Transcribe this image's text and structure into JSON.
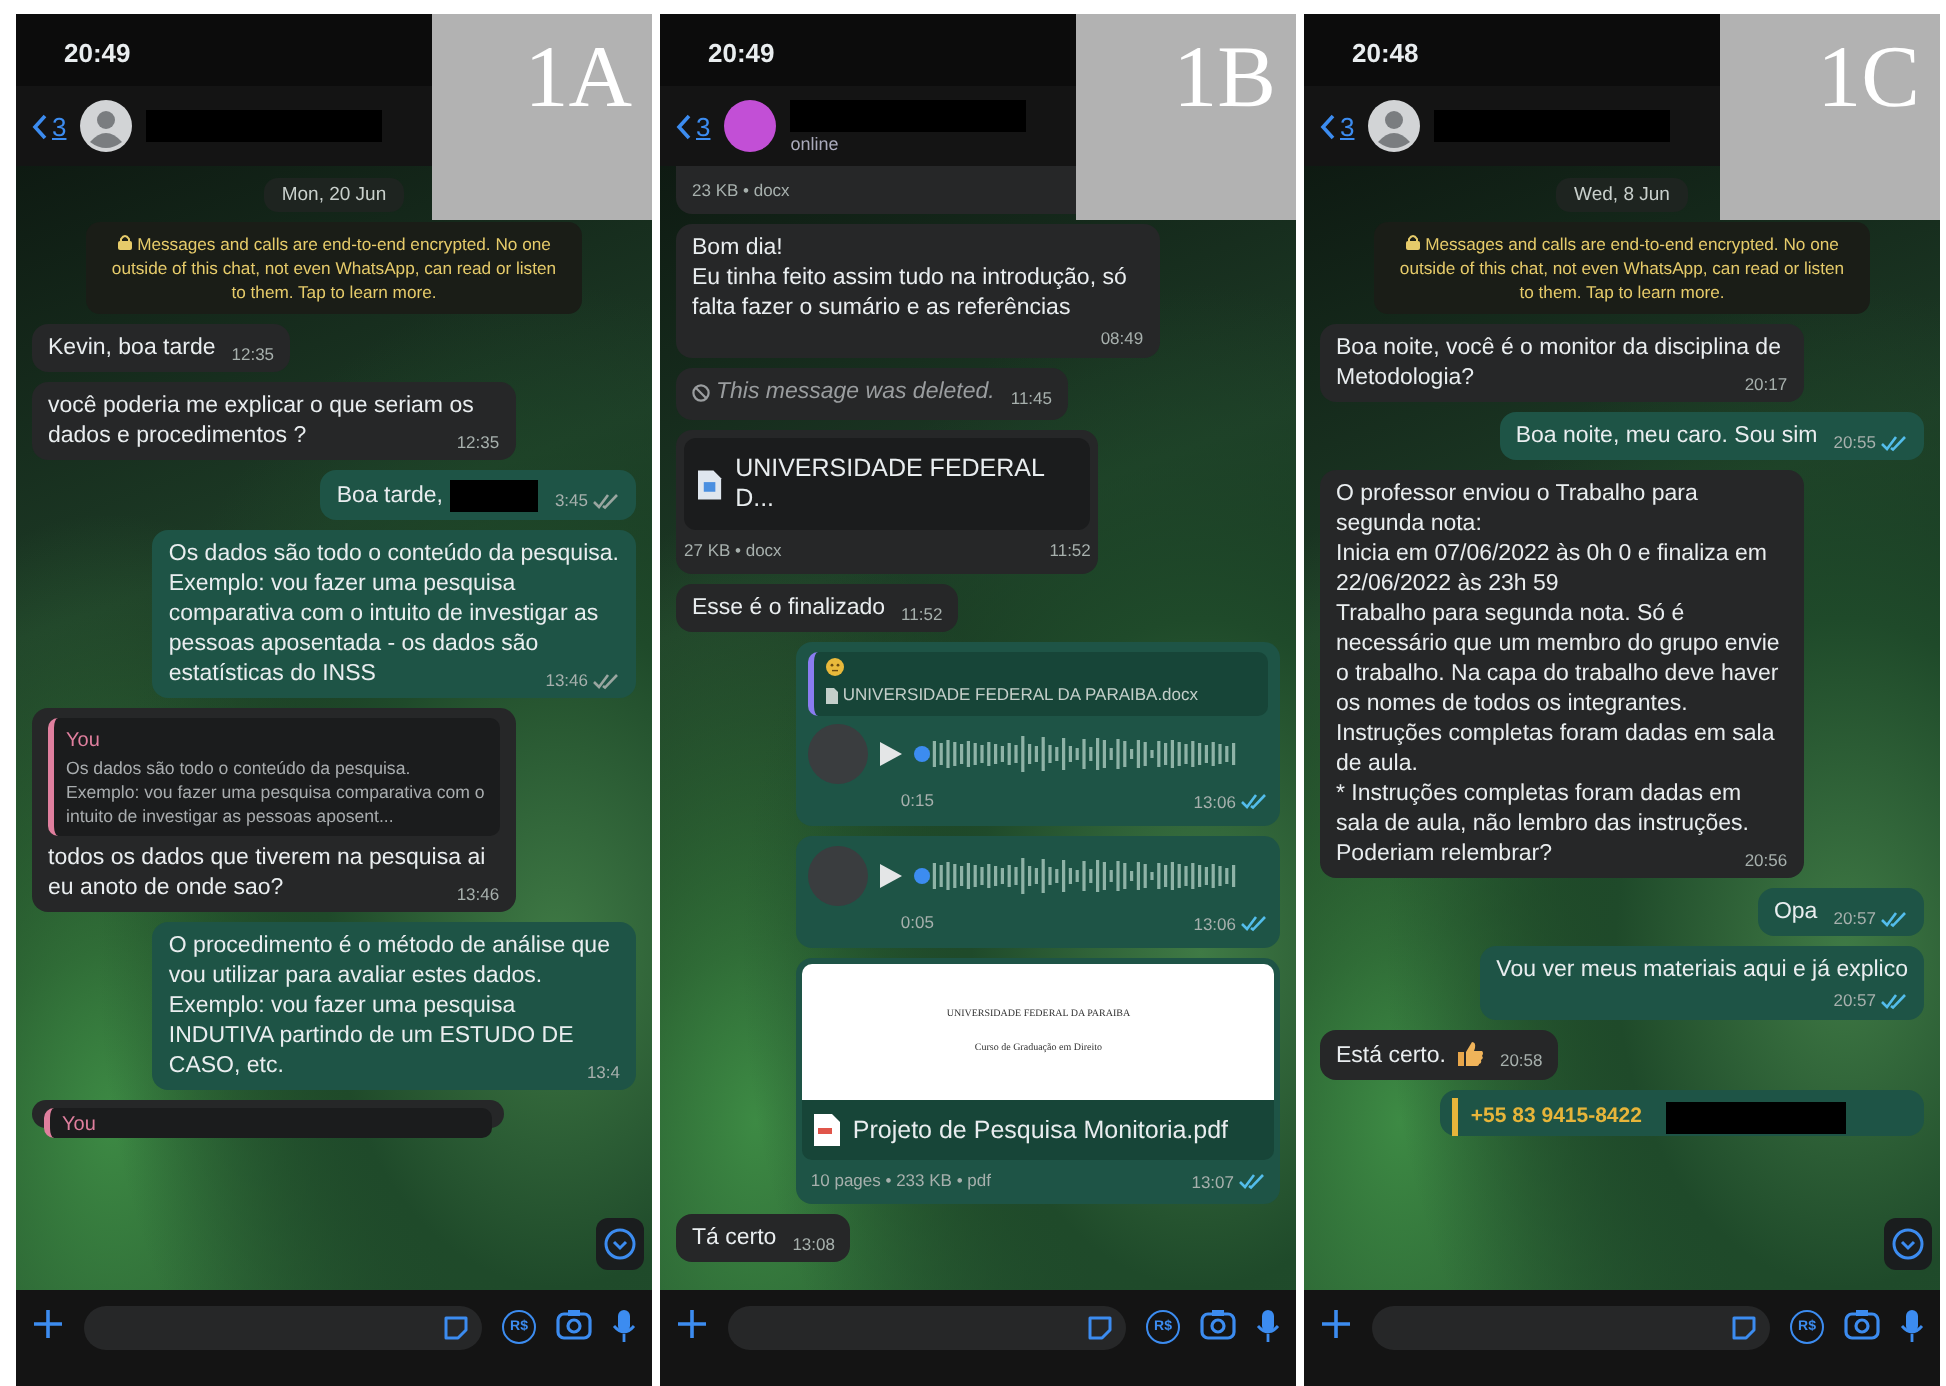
{
  "panels": [
    {
      "label": "1A",
      "status_time": "20:49",
      "back_count": "3",
      "avatar": {
        "kind": "silhouette"
      },
      "scroll_button": true,
      "payment_label": "R$",
      "messages": [
        {
          "kind": "date",
          "text": "Mon, 20 Jun"
        },
        {
          "kind": "system",
          "text": "Messages and calls are end-to-end encrypted. No one outside of this chat, not even WhatsApp, can read or listen to them. Tap to learn more."
        },
        {
          "kind": "in",
          "text": "Kevin, boa tarde",
          "time": "12:35"
        },
        {
          "kind": "in",
          "text": "você poderia me explicar o que seriam os dados e procedimentos ?",
          "time": "12:35"
        },
        {
          "kind": "out",
          "text": "Boa tarde,",
          "redacted": true,
          "time": "3:45",
          "read": false
        },
        {
          "kind": "out",
          "text": "Os dados são todo o conteúdo da pesquisa. Exemplo: vou fazer uma pesquisa comparativa com o intuito de investigar as pessoas aposentada - os dados são estatísticas do INSS",
          "time": "13:46",
          "read": false
        },
        {
          "kind": "in",
          "quote": {
            "author": "You",
            "text": "Os dados são todo o conteúdo da pesquisa. Exemplo: vou fazer uma pesquisa comparativa com o intuito de investigar as pessoas aposent..."
          },
          "text": "todos os dados que tiverem na pesquisa ai eu anoto de onde sao?",
          "time": "13:46"
        },
        {
          "kind": "out",
          "text": "O procedimento é o método de análise que vou utilizar para avaliar estes dados. Exemplo: vou fazer uma pesquisa INDUTIVA partindo de um ESTUDO DE CASO, etc.",
          "time": "13:4"
        },
        {
          "kind": "quote_stub",
          "author": "You"
        }
      ]
    },
    {
      "label": "1B",
      "status_time": "20:49",
      "back_count": "3",
      "avatar": {
        "kind": "photo"
      },
      "contact_status": "online",
      "payment_label": "R$",
      "messages": [
        {
          "kind": "doc_meta",
          "meta": "23 KB • docx"
        },
        {
          "kind": "in",
          "text": "Bom dia!\nEu tinha feito assim tudo na introdução, só falta fazer o sumário e as referências",
          "time": "08:49",
          "time_below": true
        },
        {
          "kind": "deleted",
          "text": "This message was deleted.",
          "time": "11:45"
        },
        {
          "kind": "doc",
          "name": "UNIVERSIDADE FEDERAL D...",
          "meta": "27 KB • docx",
          "time": "11:52"
        },
        {
          "kind": "in",
          "text": "Esse é o finalizado",
          "time": "11:52"
        },
        {
          "kind": "voice",
          "quote": {
            "text": "UNIVERSIDADE FEDERAL DA PARAIBA.docx"
          },
          "duration": "0:15",
          "time": "13:06",
          "read": true,
          "level": 0
        },
        {
          "kind": "voice",
          "duration": "0:05",
          "time": "13:06",
          "read": true,
          "level": 0
        },
        {
          "kind": "pdf",
          "preview_lines": [
            "UNIVERSIDADE FEDERAL DA PARAIBA",
            "Curso de Graduação em Direito"
          ],
          "name": "Projeto de Pesquisa Monitoria.pdf",
          "meta": "10 pages • 233 KB • pdf",
          "time": "13:07",
          "read": true
        },
        {
          "kind": "in",
          "text": "Tá certo",
          "time": "13:08"
        }
      ]
    },
    {
      "label": "1C",
      "status_time": "20:48",
      "back_count": "3",
      "avatar": {
        "kind": "silhouette"
      },
      "scroll_button": true,
      "payment_label": "R$",
      "messages": [
        {
          "kind": "date",
          "text": "Wed, 8 Jun"
        },
        {
          "kind": "system",
          "text": "Messages and calls are end-to-end encrypted. No one outside of this chat, not even WhatsApp, can read or listen to them. Tap to learn more."
        },
        {
          "kind": "in",
          "text": "Boa noite, você é o monitor da disciplina de Metodologia?",
          "time": "20:17"
        },
        {
          "kind": "out",
          "text": "Boa noite, meu caro. Sou sim",
          "time": "20:55",
          "read": true
        },
        {
          "kind": "in",
          "text": "O professor enviou o Trabalho para segunda nota:\nInicia em 07/06/2022 às 0h 0 e finaliza em 22/06/2022 às 23h 59\nTrabalho para segunda nota. Só é necessário que um membro do grupo envie o trabalho. Na capa do trabalho deve haver os nomes de todos os integrantes. Instruções completas foram dadas em sala de aula.\n* Instruções completas foram dadas em sala de aula, não lembro das instruções. Poderiam relembrar?",
          "time": "20:56"
        },
        {
          "kind": "out",
          "text": "Opa",
          "time": "20:57",
          "read": true
        },
        {
          "kind": "out",
          "text": "Vou ver meus materiais aqui e já explico",
          "time": "20:57",
          "read": true,
          "time_below": true
        },
        {
          "kind": "in",
          "text": "Está certo.",
          "emoji": {
            "kind": "thumbs_up"
          },
          "time": "20:58"
        },
        {
          "kind": "contact_quote",
          "text": "+55 83 9415-8422"
        }
      ]
    }
  ]
}
